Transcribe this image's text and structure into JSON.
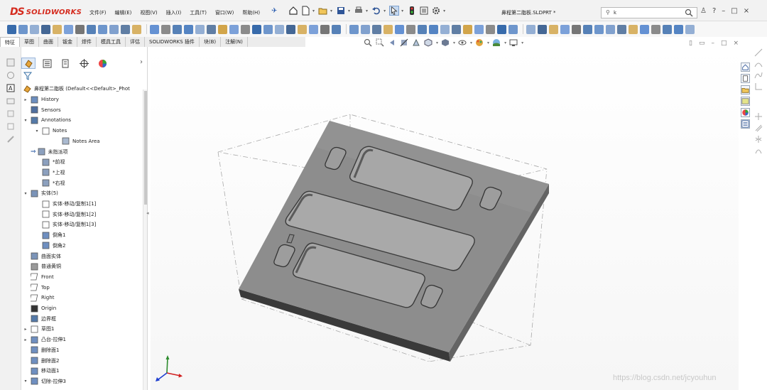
{
  "app": {
    "logo_ds": "DS",
    "logo_name": "SOLIDWORKS",
    "document_title": "鼻程第二脂板.SLDPRT *"
  },
  "menu": [
    "文件(F)",
    "编辑(E)",
    "视图(V)",
    "插入(I)",
    "工具(T)",
    "窗口(W)",
    "帮助(H)"
  ],
  "search": {
    "value": "k"
  },
  "window_controls": [
    "?",
    "–",
    "□",
    "×"
  ],
  "tabs": [
    {
      "label": "特征",
      "active": true
    },
    {
      "label": "草图",
      "active": false
    },
    {
      "label": "曲面",
      "active": false
    },
    {
      "label": "钣金",
      "active": false
    },
    {
      "label": "焊件",
      "active": false
    },
    {
      "label": "模具工具",
      "active": false
    },
    {
      "label": "评估",
      "active": false
    },
    {
      "label": "SOLIDWORKS 插件",
      "active": false
    },
    {
      "label": "块(B)",
      "active": false
    },
    {
      "label": "注解(N)",
      "active": false
    }
  ],
  "feature_tree": {
    "root": "鼻程第二脂板 (Default<<Default>_Phot",
    "items": [
      {
        "label": "History",
        "icon": "history-icon",
        "expander": "▸"
      },
      {
        "label": "Sensors",
        "icon": "sensors-icon",
        "expander": ""
      },
      {
        "label": "Annotations",
        "icon": "annotations-icon",
        "expander": "▾"
      },
      {
        "label": "Notes",
        "icon": "notes-icon",
        "expander": "▾"
      },
      {
        "label": "Notes Area",
        "icon": "notes-area-icon",
        "expander": ""
      },
      {
        "label": "未指派项",
        "icon": "unassigned-view-icon",
        "expander": ""
      },
      {
        "label": "*前视",
        "icon": "front-view-icon",
        "expander": ""
      },
      {
        "label": "*上视",
        "icon": "top-view-icon",
        "expander": ""
      },
      {
        "label": "*右视",
        "icon": "right-view-icon",
        "expander": ""
      },
      {
        "label": "实体(5)",
        "icon": "solid-bodies-icon",
        "expander": "▾"
      },
      {
        "label": "实体-移动/复制1[1]",
        "icon": "body-icon",
        "expander": ""
      },
      {
        "label": "实体-移动/复制1[2]",
        "icon": "body-icon",
        "expander": ""
      },
      {
        "label": "实体-移动/复制1[3]",
        "icon": "body-icon",
        "expander": ""
      },
      {
        "label": "倒角1",
        "icon": "chamfer-body-icon",
        "expander": ""
      },
      {
        "label": "倒角2",
        "icon": "chamfer-body-icon",
        "expander": ""
      },
      {
        "label": "曲面实体",
        "icon": "surface-bodies-icon",
        "expander": ""
      },
      {
        "label": "普通黄铜",
        "icon": "material-icon",
        "expander": ""
      },
      {
        "label": "Front",
        "icon": "plane-icon",
        "expander": ""
      },
      {
        "label": "Top",
        "icon": "plane-icon",
        "expander": ""
      },
      {
        "label": "Right",
        "icon": "plane-icon",
        "expander": ""
      },
      {
        "label": "Origin",
        "icon": "origin-icon",
        "expander": ""
      },
      {
        "label": "边界框",
        "icon": "bounding-box-icon",
        "expander": ""
      },
      {
        "label": "草图1",
        "icon": "sketch-icon",
        "expander": "▸"
      },
      {
        "label": "凸台-拉伸1",
        "icon": "boss-extrude-icon",
        "expander": "▸"
      },
      {
        "label": "删除面1",
        "icon": "delete-face-icon",
        "expander": ""
      },
      {
        "label": "删除面2",
        "icon": "delete-face-icon",
        "expander": ""
      },
      {
        "label": "移动面1",
        "icon": "move-face-icon",
        "expander": ""
      },
      {
        "label": "切除-拉伸3",
        "icon": "cut-extrude-icon",
        "expander": "▾"
      }
    ]
  },
  "watermark": "https://blog.csdn.net/jcyouhun",
  "colors": {
    "accent": "#d52b1e",
    "model_top": "#8b8b8b",
    "model_side_front": "#4a4a4a",
    "model_side_right": "#6a6a6a",
    "pocket_floor": "#a6a6a6",
    "selection_blue": "#c5d8ef"
  }
}
